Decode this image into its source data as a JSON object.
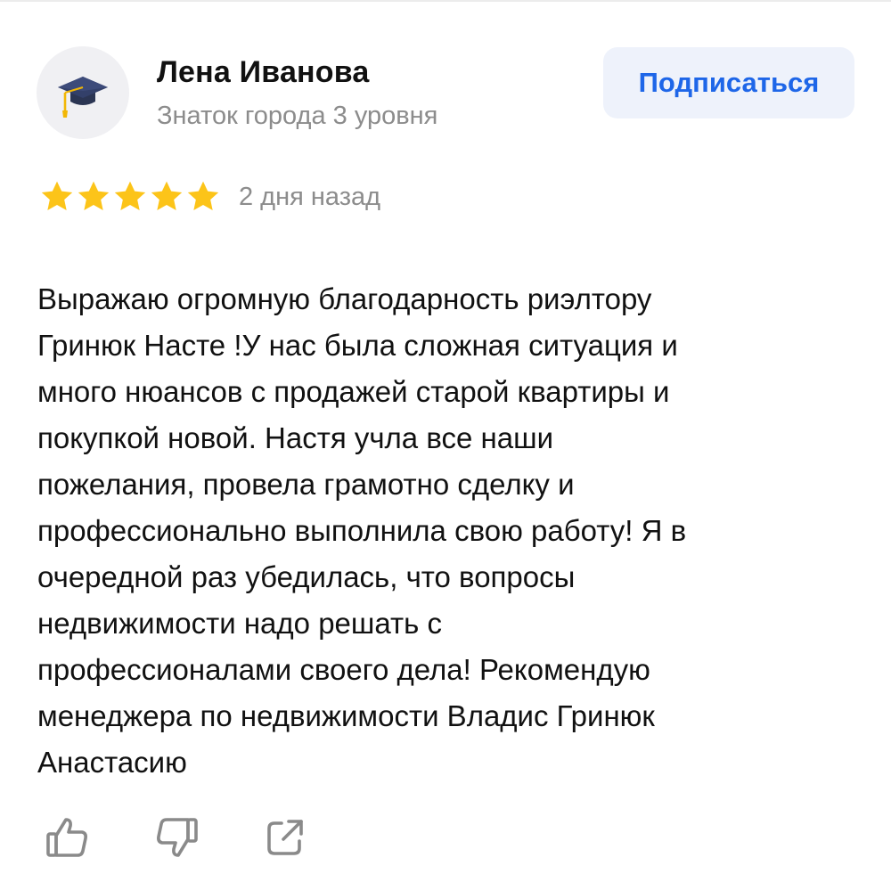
{
  "author": {
    "name": "Лена Иванова",
    "level": "Знаток города 3 уровня",
    "avatar_icon": "graduation-cap-icon"
  },
  "subscribe": {
    "label": "Подписаться"
  },
  "rating": {
    "stars": 5,
    "max": 5,
    "color": "#fcc419"
  },
  "review": {
    "date": "2 дня назад",
    "text": "Выражаю огромную благодарность риэлтору\nГринюк Насте !У нас была сложная ситуация и\nмного нюансов с продажей старой квартиры и\nпокупкой новой. Настя учла все наши\nпожелания, провела грамотно сделку и\nпрофессионально выполнила свою работу! Я в\nочередной раз убедилась, что вопросы\nнедвижимости надо решать с\nпрофессионалами своего дела! Рекомендую\nменеджера по недвижимости Владис Гринюк\nАнастасию"
  },
  "actions": {
    "like_icon": "thumbs-up-icon",
    "dislike_icon": "thumbs-down-icon",
    "share_icon": "share-icon"
  },
  "colors": {
    "accent": "#1e66e8",
    "button_bg": "#eef2fb",
    "muted_text": "#8c8c8c"
  }
}
